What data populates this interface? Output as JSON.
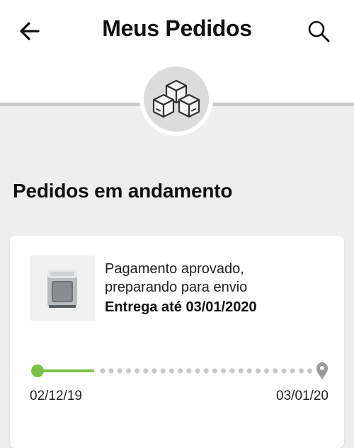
{
  "header": {
    "title": "Meus Pedidos",
    "back_icon": "arrow-left-icon",
    "search_icon": "search-icon"
  },
  "hero": {
    "icon": "boxes-icon"
  },
  "section": {
    "title": "Pedidos em andamento"
  },
  "order": {
    "status_line1": "Pagamento aprovado,",
    "status_line2": "preparando para envio",
    "delivery": "Entrega até 03/01/2020",
    "progress": {
      "start_date": "02/12/19",
      "end_date": "03/01/20",
      "fraction_complete": 0.2
    },
    "product_icon": "product-image"
  },
  "colors": {
    "accent": "#7cc242",
    "dots": "#c8c8c8",
    "background": "#eeeeee"
  }
}
